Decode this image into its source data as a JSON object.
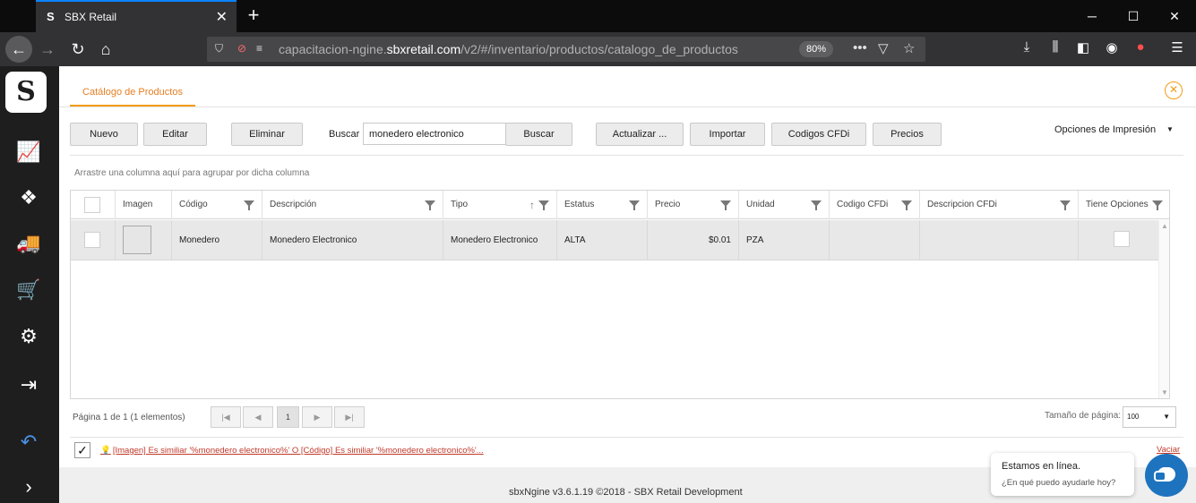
{
  "browser": {
    "tab_title": "SBX Retail",
    "url_prefix": "capacitacion-ngine.",
    "url_domain": "sbxretail.com",
    "url_path": "/v2/#/inventario/productos/catalogo_de_productos",
    "zoom": "80%"
  },
  "page": {
    "tab_label": "Catálogo de Productos"
  },
  "toolbar": {
    "nuevo": "Nuevo",
    "editar": "Editar",
    "eliminar": "Eliminar",
    "search_label": "Buscar :",
    "search_value": "monedero electronico",
    "buscar": "Buscar",
    "actualizar": "Actualizar ...",
    "importar": "Importar",
    "codigos_cfdi": "Codigos CFDi",
    "precios": "Precios",
    "print_options": "Opciones de Impresión"
  },
  "grid": {
    "group_hint": "Arrastre una columna aquí para agrupar por dicha columna",
    "headers": {
      "imagen": "Imagen",
      "codigo": "Código",
      "descripcion": "Descripción",
      "tipo": "Tipo",
      "estatus": "Estatus",
      "precio": "Precio",
      "unidad": "Unidad",
      "codigo_cfdi": "Codigo CFDi",
      "descripcion_cfdi": "Descripcion CFDi",
      "tiene_opciones": "Tiene Opciones"
    },
    "rows": [
      {
        "codigo": "Monedero",
        "descripcion": "Monedero Electronico",
        "tipo": "Monedero Electronico",
        "estatus": "ALTA",
        "precio": "$0.01",
        "unidad": "PZA",
        "codigo_cfdi": "",
        "descripcion_cfdi": ""
      }
    ]
  },
  "pager": {
    "info": "Página 1 de 1 (1 elementos)",
    "current_page": "1",
    "page_size_label": "Tamaño de página:",
    "page_size": "100"
  },
  "filter": {
    "text": "[Imagen] Es similiar '%monedero electronico%' O [Código] Es similiar '%monedero electronico%'...",
    "clear": "Vaciar"
  },
  "footer": {
    "text": "sbxNgine v3.6.1.19 ©2018 - SBX Retail Development"
  },
  "chat": {
    "title": "Estamos en línea.",
    "subtitle": "¿En qué puedo ayudarle hoy?"
  }
}
